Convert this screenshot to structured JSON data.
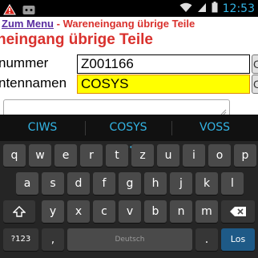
{
  "status_bar": {
    "time": "12:53",
    "left_icons": [
      "warning-icon",
      "notification-icon"
    ],
    "right_icons": [
      "wifi-icon",
      "signal-icon",
      "battery-icon"
    ]
  },
  "breadcrumb": {
    "back_label": "Zum Menu",
    "separator": " - ",
    "current": "Wareneingang übrige Teile"
  },
  "page": {
    "heading": "neingang übrige Teile"
  },
  "form": {
    "row1": {
      "label": "nummer",
      "value": "Z001166",
      "side_button": "C"
    },
    "row2": {
      "label": "ntennamen",
      "value": "COSYS",
      "side_button": "C"
    }
  },
  "keyboard": {
    "suggestions": [
      "CIWS",
      "COSYS",
      "VOSS"
    ],
    "row1": [
      "q",
      "w",
      "e",
      "r",
      "t",
      "z",
      "u",
      "i",
      "o",
      "p"
    ],
    "row2": [
      "a",
      "s",
      "d",
      "f",
      "g",
      "h",
      "j",
      "k",
      "l"
    ],
    "row3": [
      "y",
      "x",
      "c",
      "v",
      "b",
      "n",
      "m"
    ],
    "symbols_label": "?123",
    "comma": ",",
    "space_label": "Deutsch",
    "period": ".",
    "go_label": "Los"
  },
  "colors": {
    "accent_red": "#d9312d",
    "link_purple": "#5a2ca0",
    "field_highlight": "#ffff00",
    "suggestion_blue": "#33b5e5",
    "go_key": "#1e5a87"
  }
}
